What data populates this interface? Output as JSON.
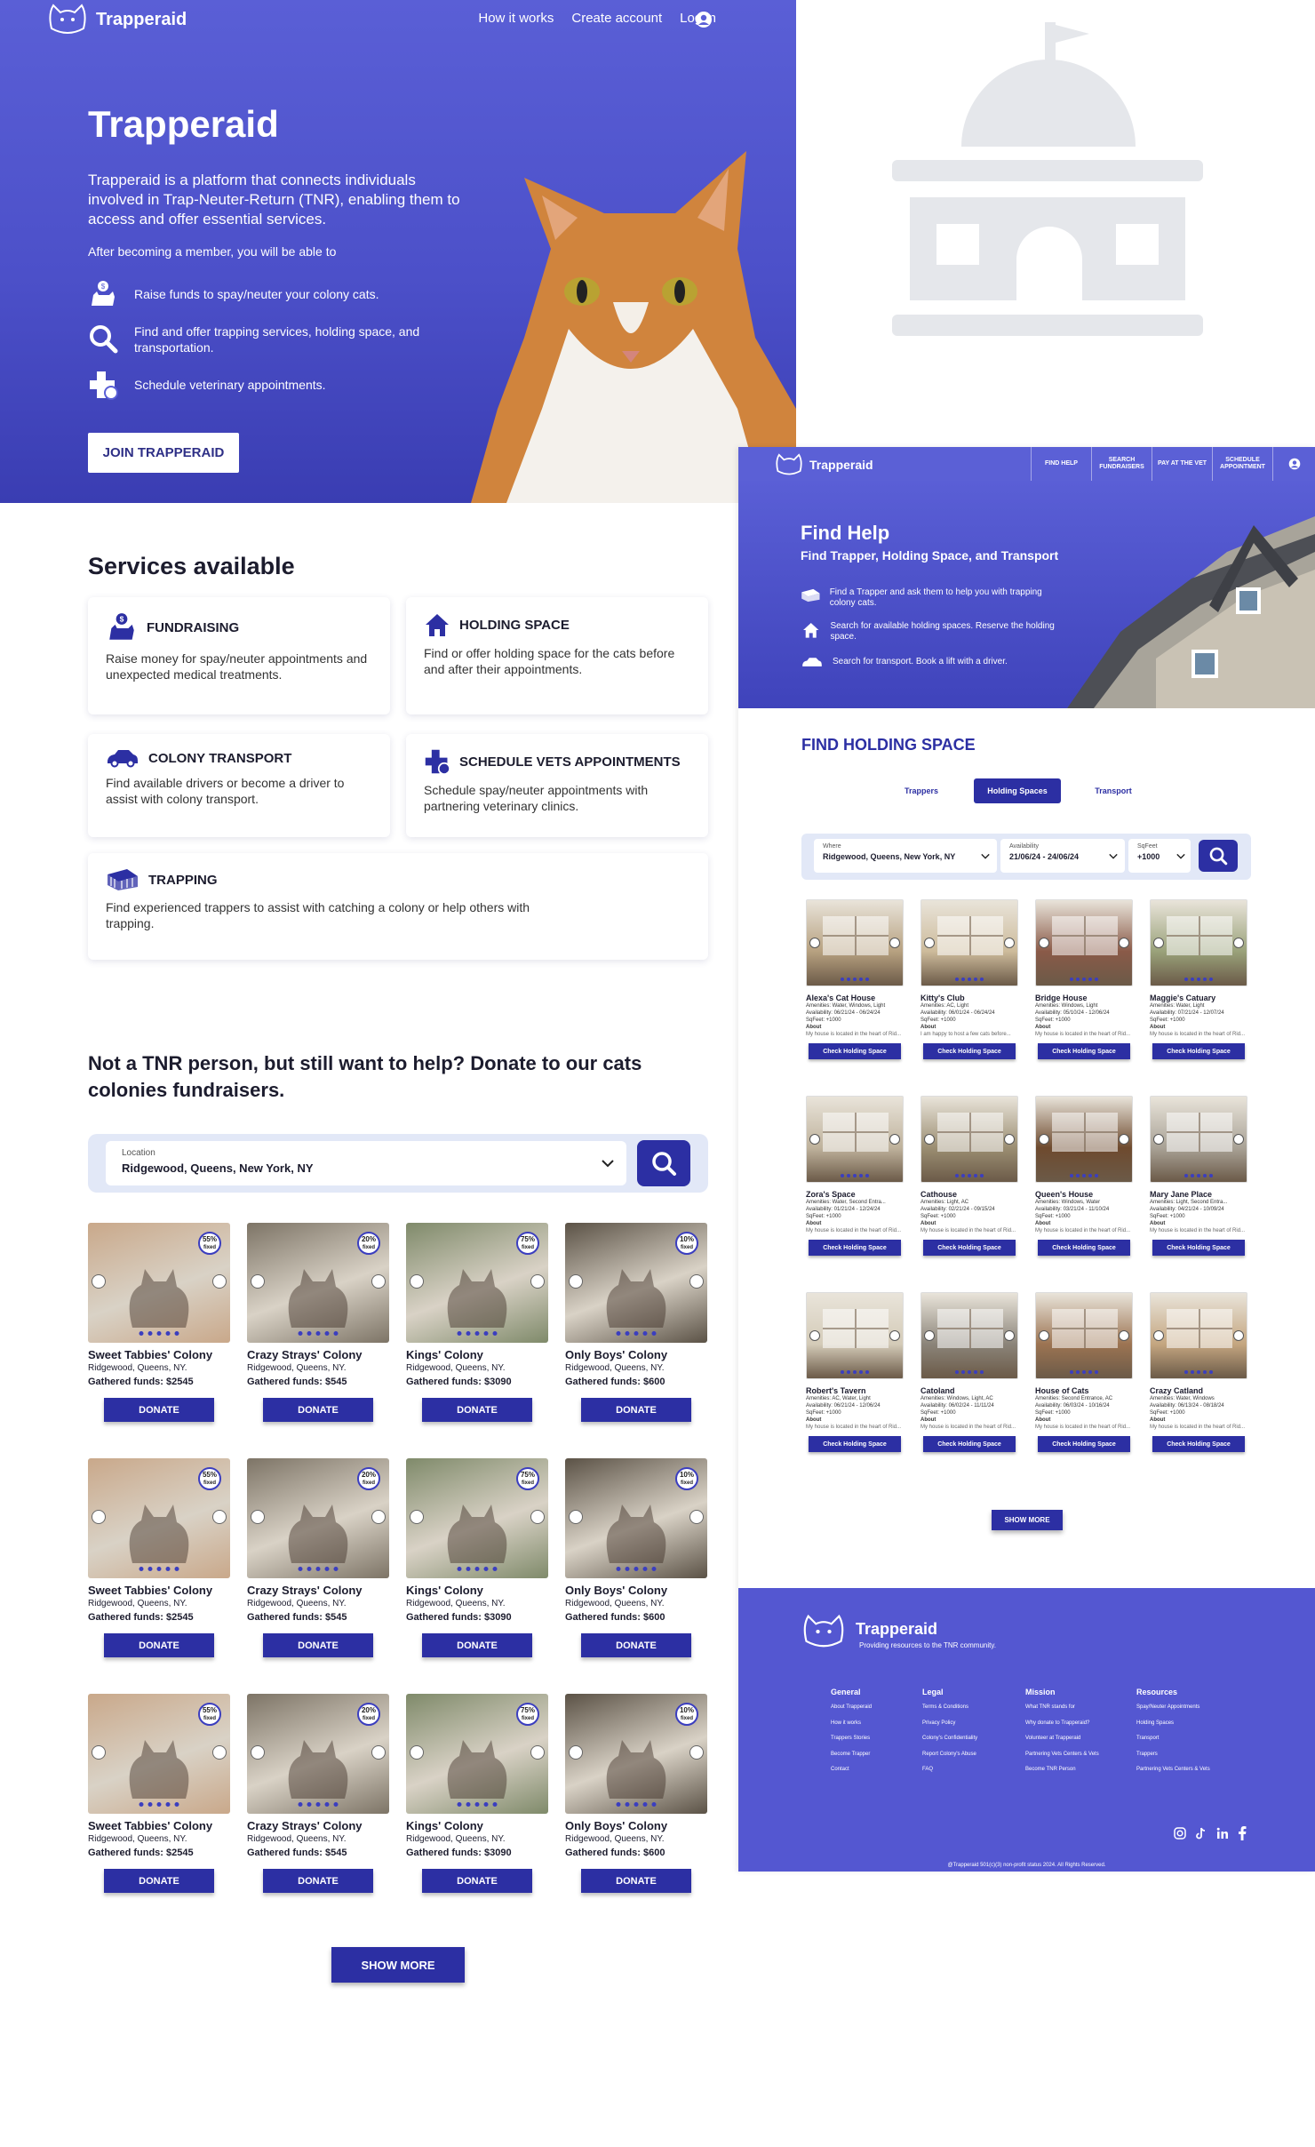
{
  "landing": {
    "nav": {
      "brand": "Trapperaid",
      "links": [
        "How it works",
        "Create account",
        "Log in"
      ]
    },
    "hero": {
      "title": "Trapperaid",
      "description": "Trapperaid is a platform that connects individuals involved in Trap-Neuter-Return (TNR), enabling them to access and offer essential services.",
      "subtitle": "After becoming a member, you will be able to",
      "features": [
        "Raise funds to spay/neuter your colony cats.",
        "Find and offer trapping services, holding space, and transportation.",
        "Schedule veterinary appointments."
      ],
      "cta": "JOIN TRAPPERAID"
    },
    "services": {
      "title": "Services available",
      "items": [
        {
          "title": "FUNDRAISING",
          "desc": "Raise money for spay/neuter appointments and unexpected medical treatments.",
          "icon": "cat-money-icon"
        },
        {
          "title": "HOLDING SPACE",
          "desc": "Find or offer holding space for the cats before and after their appointments.",
          "icon": "house-icon"
        },
        {
          "title": "COLONY TRANSPORT",
          "desc": "Find available drivers or become a driver to assist with colony transport.",
          "icon": "car-icon"
        },
        {
          "title": "SCHEDULE VETS APPOINTMENTS",
          "desc": "Schedule spay/neuter appointments with partnering veterinary clinics.",
          "icon": "medical-cross-icon"
        },
        {
          "title": "TRAPPING",
          "desc": "Find experienced trappers to assist with catching a colony or help others with trapping.",
          "icon": "trap-cage-icon"
        }
      ]
    },
    "donate": {
      "title": "Not a TNR person, but still want to help? Donate to our cats colonies fundraisers.",
      "search": {
        "label": "Location",
        "value": "Ridgewood, Queens, New York, NY"
      },
      "colonies": [
        {
          "name": "Sweet Tabbies' Colony",
          "location": "Ridgewood, Queens, NY.",
          "funds": "Gathered funds: $2545",
          "badge": "55%",
          "badge_sub": "fixed",
          "color": "#c9a88a"
        },
        {
          "name": "Crazy Strays' Colony",
          "location": "Ridgewood, Queens, NY.",
          "funds": "Gathered funds: $545",
          "badge": "20%",
          "badge_sub": "fixed",
          "color": "#7d7466"
        },
        {
          "name": "Kings' Colony",
          "location": "Ridgewood, Queens, NY.",
          "funds": "Gathered funds: $3090",
          "badge": "75%",
          "badge_sub": "fixed",
          "color": "#7f8a6a"
        },
        {
          "name": "Only Boys' Colony",
          "location": "Ridgewood, Queens, NY.",
          "funds": "Gathered funds: $600",
          "badge": "10%",
          "badge_sub": "fixed",
          "color": "#5b5246"
        }
      ],
      "button": "DONATE",
      "show_more": "SHOW MORE"
    }
  },
  "find_help": {
    "nav": {
      "brand": "Trapperaid",
      "tabs": [
        "FIND HELP",
        "SEARCH FUNDRAISERS",
        "PAY AT THE VET",
        "SCHEDULE APPOINTMENT"
      ]
    },
    "hero": {
      "title": "Find Help",
      "subtitle": "Find Trapper, Holding Space, and Transport",
      "features": [
        "Find a Trapper and ask them to help you with trapping colony cats.",
        "Search for available holding spaces. Reserve the holding space.",
        "Search for transport. Book a lift with a driver."
      ]
    },
    "section_title": "FIND HOLDING SPACE",
    "tabs": [
      "Trappers",
      "Holding Spaces",
      "Transport"
    ],
    "search": {
      "where_label": "Where",
      "where_value": "Ridgewood, Queens, New York, NY",
      "availability_label": "Availability",
      "availability_value": "21/06/24 - 24/06/24",
      "sqfeet_label": "SqFeet",
      "sqfeet_value": "+1000"
    },
    "spaces": [
      {
        "name": "Alexa's Cat House",
        "amenities": "Amenities: Water, Windows, Light",
        "availability": "Availability: 06/21/24 - 06/24/24",
        "sqfeet": "SqFeet: +1000",
        "about": "My house is located in the heart of Rid...",
        "color": "#b7a180"
      },
      {
        "name": "Kitty's Club",
        "amenities": "Amenities: AC, Light",
        "availability": "Availability: 06/01/24 - 06/24/24",
        "sqfeet": "SqFeet: +1000",
        "about": "I am happy to host a few cats before...",
        "color": "#cdbb9b"
      },
      {
        "name": "Bridge House",
        "amenities": "Amenities: Windows, Light",
        "availability": "Availability: 05/10/24 - 12/06/24",
        "sqfeet": "SqFeet: +1000",
        "about": "My house is located in the heart of Rid...",
        "color": "#8a5a48"
      },
      {
        "name": "Maggie's Catuary",
        "amenities": "Amenities: Water, Light",
        "availability": "Availability: 07/21/24 - 12/07/24",
        "sqfeet": "SqFeet: +1000",
        "about": "My house is located in the heart of Rid...",
        "color": "#9aa27a"
      },
      {
        "name": "Zora's Space",
        "amenities": "Amenities: Water, Second Entra...",
        "availability": "Availability: 01/21/24 - 12/24/24",
        "sqfeet": "SqFeet: +1000",
        "about": "My house is located in the heart of Rid...",
        "color": "#bfb29c"
      },
      {
        "name": "Cathouse",
        "amenities": "Amenities: Light, AC",
        "availability": "Availability: 02/21/24 - 09/15/24",
        "sqfeet": "SqFeet: +1000",
        "about": "My house is located in the heart of Rid...",
        "color": "#9b8e72"
      },
      {
        "name": "Queen's House",
        "amenities": "Amenities: Windows, Water",
        "availability": "Availability: 03/21/24 - 11/10/24",
        "sqfeet": "SqFeet: +1000",
        "about": "My house is located in the heart of Rid...",
        "color": "#6e4a2e"
      },
      {
        "name": "Mary Jane Place",
        "amenities": "Amenities: Light, Second Entra...",
        "availability": "Availability: 04/21/24 - 10/09/24",
        "sqfeet": "SqFeet: +1000",
        "about": "My house is located in the heart of Rid...",
        "color": "#a9a296"
      },
      {
        "name": "Robert's Tavern",
        "amenities": "Amenities: AC, Water, Light",
        "availability": "Availability: 06/21/24 - 12/06/24",
        "sqfeet": "SqFeet: +1000",
        "about": "My house is located in the heart of Rid...",
        "color": "#d4cbb8"
      },
      {
        "name": "Catoland",
        "amenities": "Amenities: Windows, Light, AC",
        "availability": "Availability: 06/02/24 - 11/11/24",
        "sqfeet": "SqFeet: +1000",
        "about": "My house is located in the heart of Rid...",
        "color": "#8b8479"
      },
      {
        "name": "House of Cats",
        "amenities": "Amenities: Second Entrance, AC",
        "availability": "Availability: 06/03/24 - 10/16/24",
        "sqfeet": "SqFeet: +1000",
        "about": "My house is located in the heart of Rid...",
        "color": "#9c7452"
      },
      {
        "name": "Crazy Catland",
        "amenities": "Amenities: Water, Windows",
        "availability": "Availability: 06/13/24 - 08/18/24",
        "sqfeet": "SqFeet: +1000",
        "about": "My house is located in the heart of Rid...",
        "color": "#c4a680"
      }
    ],
    "about_label": "About",
    "card_button": "Check Holding Space",
    "show_more": "SHOW MORE",
    "footer": {
      "brand": "Trapperaid",
      "tagline": "Providing resources to the TNR community.",
      "columns": [
        {
          "title": "General",
          "links": [
            "About Trapperaid",
            "How it works",
            "Trappers Stories",
            "Become Trapper",
            "Contact"
          ]
        },
        {
          "title": "Legal",
          "links": [
            "Terms & Conditions",
            "Privacy Policy",
            "Colony's Confidentiality",
            "Report Colony's Abuse",
            "FAQ"
          ]
        },
        {
          "title": "Mission",
          "links": [
            "What TNR stands for",
            "Why donate to Trapperaid?",
            "Volunteer at Trapperaid",
            "Partnering Vets Centers & Vets",
            "Become TNR Person"
          ]
        },
        {
          "title": "Resources",
          "links": [
            "Spay/Neuter Appointments",
            "Holding Spaces",
            "Transport",
            "Trappers",
            "Partnering Vets Centers & Vets"
          ]
        }
      ],
      "copyright": "@Trapperaid 501(c)(3) non-profit status 2024. All Rights Reserved."
    }
  },
  "colors": {
    "primary": "#5a5fd6",
    "dark": "#2c2fa3",
    "placeholder": "#e5e7eb"
  }
}
